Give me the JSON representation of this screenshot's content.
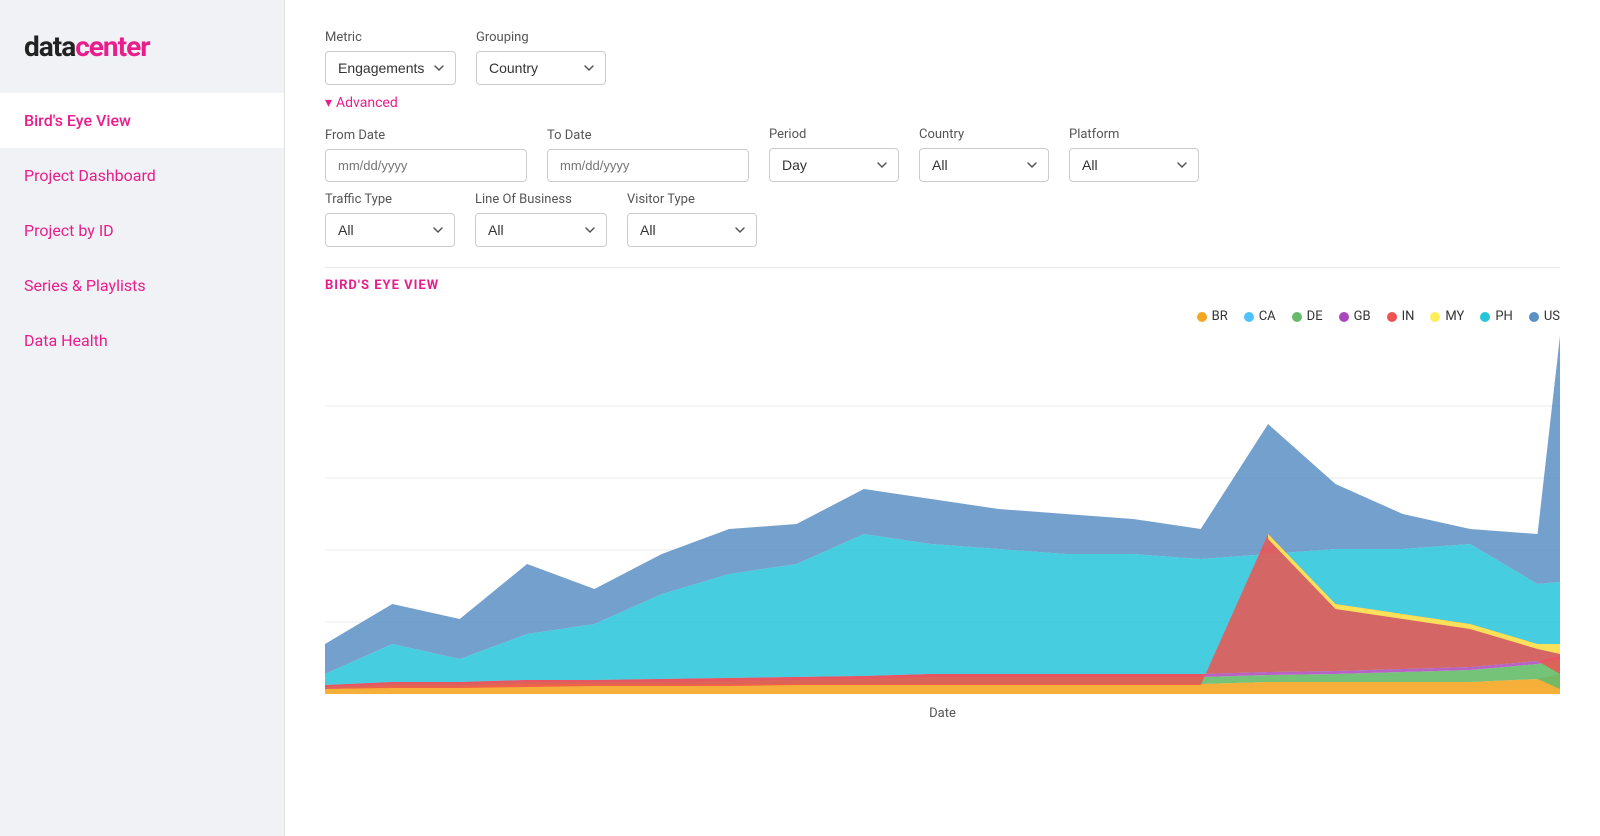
{
  "app": {
    "logo_data": "data",
    "logo_center": "center",
    "title": "datacenter"
  },
  "sidebar": {
    "items": [
      {
        "id": "birds-eye-view",
        "label": "Bird's Eye View",
        "active": true
      },
      {
        "id": "project-dashboard",
        "label": "Project Dashboard",
        "active": false
      },
      {
        "id": "project-by-id",
        "label": "Project by ID",
        "active": false
      },
      {
        "id": "series-playlists",
        "label": "Series & Playlists",
        "active": false
      },
      {
        "id": "data-health",
        "label": "Data Health",
        "active": false
      }
    ]
  },
  "filters": {
    "metric_label": "Metric",
    "metric_value": "Engagements",
    "grouping_label": "Grouping",
    "grouping_value": "Country",
    "advanced_label": "Advanced",
    "from_date_label": "From Date",
    "from_date_placeholder": "mm/dd/yyyy",
    "to_date_label": "To Date",
    "to_date_placeholder": "mm/dd/yyyy",
    "period_label": "Period",
    "period_value": "Day",
    "country_label": "Country",
    "country_value": "All",
    "platform_label": "Platform",
    "platform_value": "All",
    "traffic_type_label": "Traffic Type",
    "traffic_type_value": "All",
    "line_of_business_label": "Line Of Business",
    "line_of_business_value": "All",
    "visitor_type_label": "Visitor Type",
    "visitor_type_value": "All"
  },
  "chart": {
    "title": "BIRD'S EYE VIEW",
    "date_label": "Date",
    "legend": [
      {
        "code": "BR",
        "color": "#f5a623"
      },
      {
        "code": "CA",
        "color": "#4fc3f7"
      },
      {
        "code": "DE",
        "color": "#66bb6a"
      },
      {
        "code": "GB",
        "color": "#ab47bc"
      },
      {
        "code": "IN",
        "color": "#ef5350"
      },
      {
        "code": "MY",
        "color": "#ffee58"
      },
      {
        "code": "PH",
        "color": "#26c6da"
      },
      {
        "code": "US",
        "color": "#5c8fc4"
      }
    ]
  }
}
